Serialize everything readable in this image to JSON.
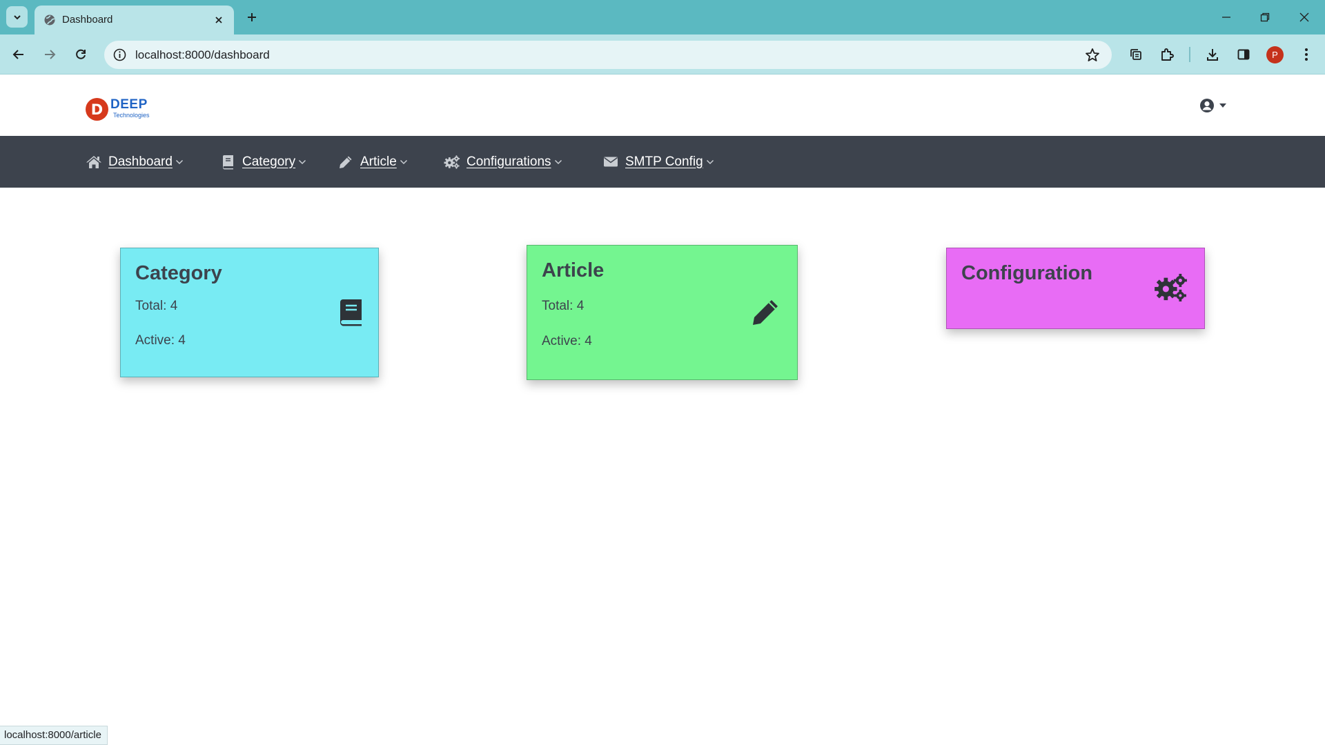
{
  "browser": {
    "tab_title": "Dashboard",
    "url": "localhost:8000/dashboard",
    "profile_initial": "P",
    "status_url": "localhost:8000/article"
  },
  "header": {
    "logo_letter": "D",
    "logo_word": "DEEP",
    "logo_sub": "Technologies"
  },
  "nav": {
    "items": [
      {
        "label": "Dashboard",
        "icon": "home-icon"
      },
      {
        "label": "Category",
        "icon": "book-icon"
      },
      {
        "label": "Article",
        "icon": "pencil-icon"
      },
      {
        "label": "Configurations",
        "icon": "gears-icon"
      },
      {
        "label": "SMTP Config",
        "icon": "envelope-icon"
      }
    ]
  },
  "cards": [
    {
      "title": "Category",
      "total": "Total: 4",
      "active": "Active: 4",
      "icon": "book-icon",
      "color": "#78ebf3"
    },
    {
      "title": "Article",
      "total": "Total: 4",
      "active": "Active: 4",
      "icon": "pencil-icon",
      "color": "#74f590"
    },
    {
      "title": "Configuration",
      "icon": "gears-icon",
      "color": "#e86cf5"
    }
  ],
  "colors": {
    "tabstrip": "#5bb9c1",
    "navbar": "#3d434d"
  }
}
